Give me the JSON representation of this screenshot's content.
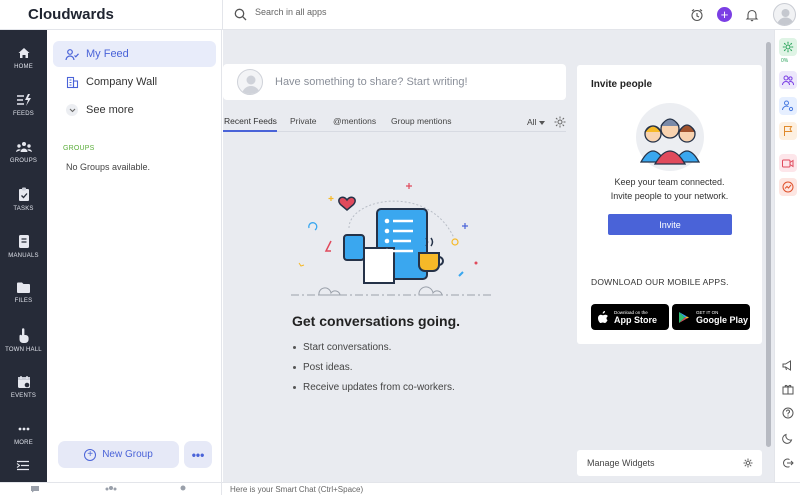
{
  "app": {
    "brand": "Cloudwards"
  },
  "search": {
    "placeholder": "Search in all apps"
  },
  "header": {
    "icons": [
      "alarm-clock-icon",
      "plus-icon",
      "bell-icon",
      "user-avatar-icon"
    ],
    "accent": "#7b3fe4"
  },
  "leftnav": {
    "items": [
      {
        "label": "HOME",
        "icon": "home-icon"
      },
      {
        "label": "FEEDS",
        "icon": "feeds-icon"
      },
      {
        "label": "GROUPS",
        "icon": "groups-icon"
      },
      {
        "label": "TASKS",
        "icon": "tasks-icon"
      },
      {
        "label": "MANUALS",
        "icon": "manuals-icon"
      },
      {
        "label": "FILES",
        "icon": "files-icon"
      },
      {
        "label": "TOWN HALL",
        "icon": "town-hall-icon"
      },
      {
        "label": "EVENTS",
        "icon": "events-icon"
      },
      {
        "label": "MORE",
        "icon": "more-icon"
      }
    ],
    "bg": "#262b38"
  },
  "sidebar": {
    "items": [
      {
        "label": "My Feed",
        "icon": "my-feed-icon",
        "active": true
      },
      {
        "label": "Company Wall",
        "icon": "company-wall-icon"
      },
      {
        "label": "See more",
        "icon": "chevron-down-icon"
      }
    ],
    "groups_heading": "GROUPS",
    "no_groups": "No Groups available.",
    "new_group": "New Group",
    "more": "•••"
  },
  "composer": {
    "placeholder": "Have something to share? Start writing!"
  },
  "tabs": [
    {
      "label": "Recent Feeds",
      "active": true
    },
    {
      "label": "Private"
    },
    {
      "label": "@mentions"
    },
    {
      "label": "Group mentions"
    }
  ],
  "filter": {
    "label": "All"
  },
  "empty": {
    "title": "Get conversations going.",
    "bullets": [
      "Start conversations.",
      "Post ideas.",
      "Receive updates from co-workers."
    ]
  },
  "invite": {
    "title": "Invite people",
    "line1": "Keep your team connected.",
    "line2": "Invite people to your network.",
    "button": "Invite"
  },
  "apps": {
    "title": "DOWNLOAD OUR MOBILE APPS.",
    "appstore_small": "Download on the",
    "appstore_big": "App Store",
    "play_small": "GET IT ON",
    "play_big": "Google Play"
  },
  "widgets": {
    "label": "Manage Widgets"
  },
  "rightrail": {
    "progress": "0%"
  },
  "chat": {
    "placeholder": "Here is your Smart Chat (Ctrl+Space)"
  }
}
